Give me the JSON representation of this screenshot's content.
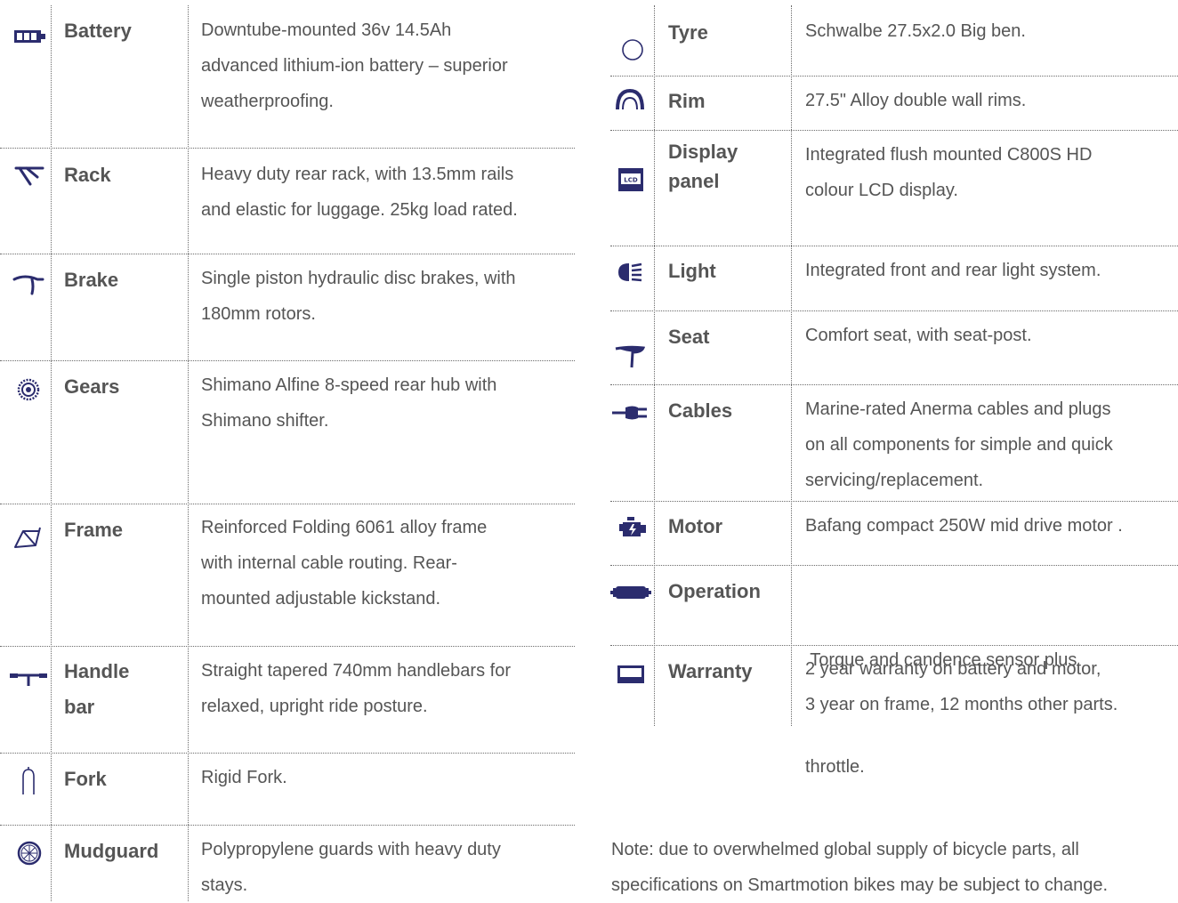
{
  "left_specs": [
    {
      "label_lines": [
        "Battery"
      ],
      "desc_lines": [
        "Downtube-mounted 36v 14.5Ah",
        "advanced lithium-ion battery – superior",
        "weatherproofing."
      ],
      "icon": "battery-icon"
    },
    {
      "label_lines": [
        "Rack"
      ],
      "desc_lines": [
        "Heavy duty rear rack, with 13.5mm rails",
        "and elastic for luggage. 25kg load rated."
      ],
      "icon": "rack-icon"
    },
    {
      "label_lines": [
        "Brake"
      ],
      "desc_lines": [
        "Single piston hydraulic disc brakes, with",
        "180mm rotors."
      ],
      "icon": "brake-lever-icon"
    },
    {
      "label_lines": [
        "Gears"
      ],
      "desc_lines": [
        "Shimano Alfine 8-speed rear hub  with",
        "Shimano shifter."
      ],
      "icon": "gear-cassette-icon"
    },
    {
      "label_lines": [
        "Frame"
      ],
      "desc_lines": [
        "Reinforced Folding 6061 alloy frame",
        "with internal cable routing. Rear-",
        "mounted adjustable kickstand."
      ],
      "icon": "frame-icon"
    },
    {
      "label_lines": [
        "Handle",
        "bar"
      ],
      "desc_lines": [
        "Straight tapered 740mm handlebars for",
        "relaxed, upright ride posture."
      ],
      "icon": "handlebar-icon"
    },
    {
      "label_lines": [
        "Fork"
      ],
      "desc_lines": [
        "Rigid Fork."
      ],
      "icon": "fork-icon"
    },
    {
      "label_lines": [
        "Mudguard"
      ],
      "desc_lines": [
        "Polypropylene guards with heavy duty",
        "stays."
      ],
      "icon": "mudguard-wheel-icon"
    }
  ],
  "right_specs": [
    {
      "label_lines": [
        "Tyre"
      ],
      "desc_lines": [
        "Schwalbe 27.5x2.0 Big ben."
      ],
      "icon": "tyre-icon"
    },
    {
      "label_lines": [
        "Rim"
      ],
      "desc_lines": [
        "27.5\" Alloy double wall rims."
      ],
      "icon": "rim-icon"
    },
    {
      "label_lines": [
        "Display",
        "panel"
      ],
      "desc_lines": [
        "Integrated flush mounted C800S HD",
        "colour LCD display."
      ],
      "icon": "lcd-display-icon",
      "icon_text": "LCD"
    },
    {
      "label_lines": [
        "Light"
      ],
      "desc_lines": [
        "Integrated front and rear light system."
      ],
      "icon": "headlight-icon"
    },
    {
      "label_lines": [
        "Seat"
      ],
      "desc_lines": [
        "Comfort seat, with seat-post."
      ],
      "icon": "seat-icon"
    },
    {
      "label_lines": [
        "Cables"
      ],
      "desc_lines": [
        "Marine-rated Anerma cables and plugs",
        "on all components for simple and quick",
        "servicing/replacement."
      ],
      "icon": "cable-plug-icon"
    },
    {
      "label_lines": [
        "Motor"
      ],
      "desc_lines": [
        "Bafang compact 250W mid drive motor ."
      ],
      "icon": "motor-icon"
    },
    {
      "label_lines": [
        "Operation"
      ],
      "desc_lines": [
        " Torque and candence sensor plus",
        "throttle."
      ],
      "icon": "sensor-icon"
    },
    {
      "label_lines": [
        "Warranty"
      ],
      "desc_lines": [
        "2 year warranty on battery and motor,",
        "3 year on frame, 12 months other parts."
      ],
      "icon": "warranty-card-icon"
    }
  ],
  "note_lines": [
    "Note: due to overwhelmed global supply of bicycle parts, all",
    "specifications on Smartmotion bikes may be subject to change."
  ],
  "colors": {
    "text": "#555555",
    "icon": "#2b2c6e",
    "rule": "#6b6b6b"
  }
}
